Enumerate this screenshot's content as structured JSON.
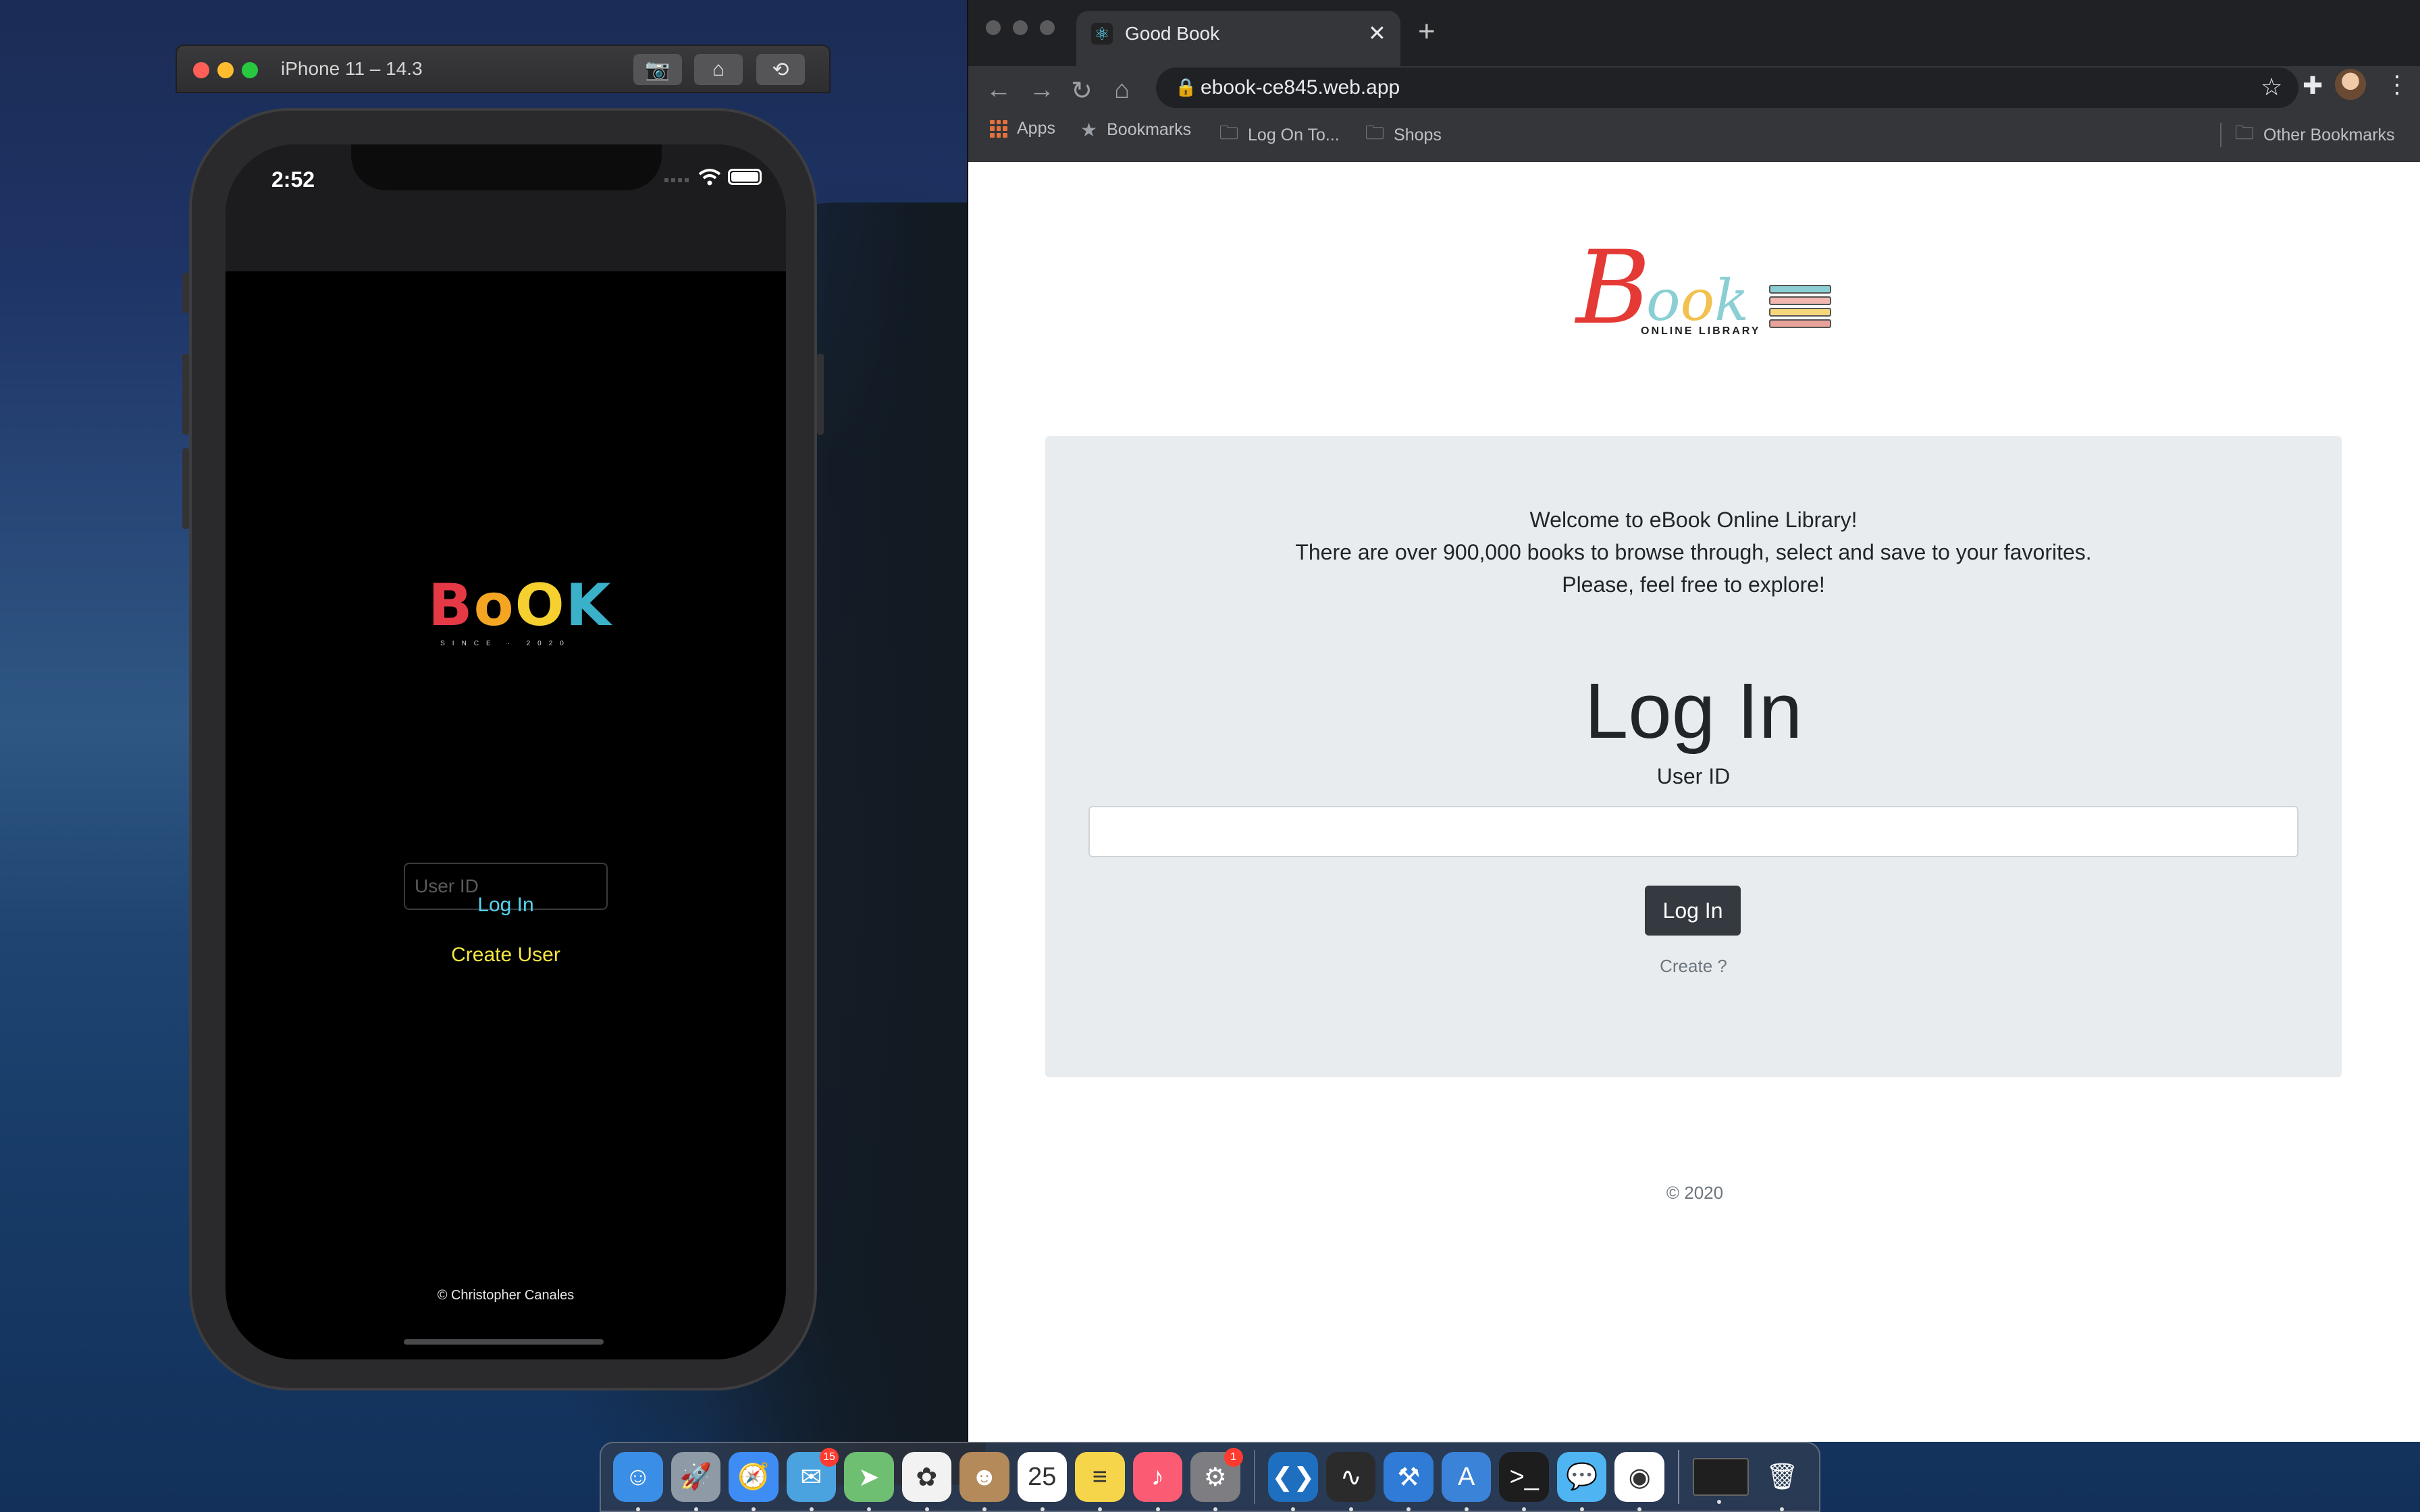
{
  "simulator": {
    "title": "iPhone 11 – 14.3",
    "status_time": "2:52",
    "app": {
      "logo_letters": [
        "B",
        "o",
        "O",
        "K"
      ],
      "logo_colors": [
        "#e63946",
        "#f4a623",
        "#f5d02f",
        "#3ab0c9"
      ],
      "since_text": "SINCE · 2020",
      "user_id_placeholder": "User ID",
      "login_label": "Log In",
      "create_label": "Create User",
      "copyright": "© Christopher Canales",
      "login_color": "#52d6f0",
      "create_color": "#f5e642"
    }
  },
  "browser": {
    "tab_title": "Good Book",
    "url": "ebook-ce845.web.app",
    "bookmarks": [
      "Apps",
      "Bookmarks",
      "Log On To...",
      "Shops"
    ],
    "other_bookmarks": "Other Bookmarks"
  },
  "web": {
    "logo": {
      "big_letter": "B",
      "rest": "ook",
      "subtitle": "ONLINE LIBRARY",
      "book_colors": [
        "#8bcfd4",
        "#f2b8b0",
        "#f5d67a",
        "#e9a29a"
      ]
    },
    "welcome_lines": [
      "Welcome to eBook Online Library!",
      "There are over 900,000 books to browse through, select and save to your favorites.",
      "Please, feel free to explore!"
    ],
    "heading": "Log In",
    "user_id_label": "User ID",
    "user_id_value": "",
    "login_button": "Log In",
    "create_link": "Create ?",
    "footer": "© 2020"
  },
  "dock": {
    "items": [
      {
        "name": "finder-icon",
        "glyph": "☺",
        "bg": "#3a8ee6"
      },
      {
        "name": "launchpad-icon",
        "glyph": "🚀",
        "bg": "#8e9aa6"
      },
      {
        "name": "safari-icon",
        "glyph": "🧭",
        "bg": "#3d8df5"
      },
      {
        "name": "mail-icon",
        "glyph": "✉",
        "bg": "#4aa3df",
        "badge": "15"
      },
      {
        "name": "maps-icon",
        "glyph": "➤",
        "bg": "#6fbf73"
      },
      {
        "name": "photos-icon",
        "glyph": "✿",
        "bg": "#f2f2f2"
      },
      {
        "name": "contacts-icon",
        "glyph": "☻",
        "bg": "#b48a5a"
      },
      {
        "name": "calendar-icon",
        "glyph": "25",
        "bg": "#ffffff"
      },
      {
        "name": "notes-icon",
        "glyph": "≡",
        "bg": "#f7d54a"
      },
      {
        "name": "music-icon",
        "glyph": "♪",
        "bg": "#fb5c74"
      },
      {
        "name": "system-preferences-icon",
        "glyph": "⚙",
        "bg": "#7d7d82",
        "badge": "1"
      },
      {
        "name": "vscode-icon",
        "glyph": "❮❯",
        "bg": "#1e6fc0"
      },
      {
        "name": "activity-monitor-icon",
        "glyph": "∿",
        "bg": "#2b2b2b"
      },
      {
        "name": "xcode-icon",
        "glyph": "⚒",
        "bg": "#2f7bd6"
      },
      {
        "name": "instruments-icon",
        "glyph": "A",
        "bg": "#3b82d9"
      },
      {
        "name": "terminal-icon",
        "glyph": ">_",
        "bg": "#1d1d1d"
      },
      {
        "name": "messages-icon",
        "glyph": "💬",
        "bg": "#4fb4f2"
      },
      {
        "name": "chrome-icon",
        "glyph": "◉",
        "bg": "#ffffff"
      }
    ],
    "trailing": [
      {
        "name": "recent-window-icon",
        "glyph": "",
        "bg": "#1f1f1f"
      },
      {
        "name": "trash-icon",
        "glyph": "🗑",
        "bg": "transparent"
      }
    ]
  }
}
